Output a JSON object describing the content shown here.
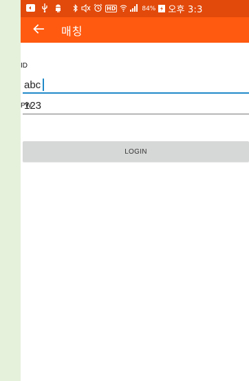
{
  "status_bar": {
    "battery_percent": "84%",
    "hd_label": "HD",
    "time": "오후 3:3"
  },
  "app_bar": {
    "title": "매칭",
    "back_icon": "arrow-left-icon"
  },
  "form": {
    "id_label": "ID",
    "id_value": "abc",
    "pw_label": "PW",
    "pw_value": "123",
    "login_label": "LOGIN"
  },
  "colors": {
    "status_bar": "#e24a0b",
    "app_bar": "#ff5a0f",
    "focus": "#1e88c8",
    "button": "#d6d7d7",
    "side_panel": "#e6f1dc"
  }
}
